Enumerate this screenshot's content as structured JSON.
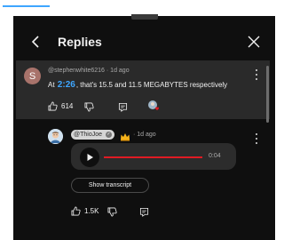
{
  "header": {
    "title": "Replies"
  },
  "parent_comment": {
    "avatar_letter": "S",
    "author": "@stephenwhite6216",
    "age": "1d ago",
    "text_prefix": "At",
    "timestamp": "2:26",
    "text_suffix": ", that's 15.5 and 11.5 MEGABYTES respectively",
    "likes": "614",
    "avatar_color": "#a8736b"
  },
  "reply": {
    "author": "@ThioJoe",
    "age": "1d ago",
    "voice_duration": "0:04",
    "playback_progress": 0.0,
    "show_transcript_label": "Show transcript",
    "likes": "1.5K"
  },
  "colors": {
    "background": "#0f0f0f",
    "highlight": "#2a2a2a",
    "link": "#3ea6ff",
    "accent_red": "#e01b24"
  }
}
